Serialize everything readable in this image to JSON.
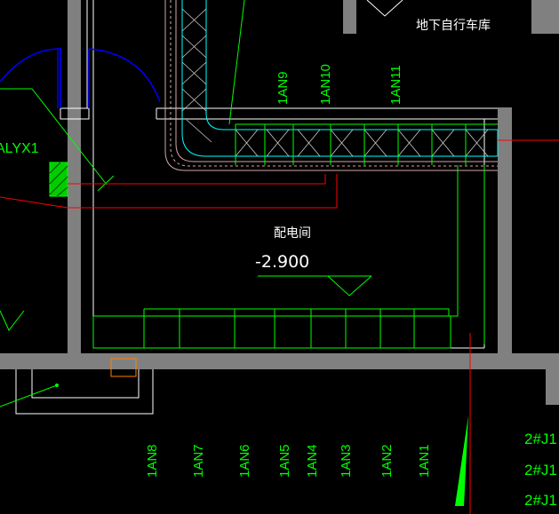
{
  "drawing": {
    "room_label": "地下自行车库",
    "electrical_room_label": "配电间",
    "elevation": "-2.900",
    "panel_label": "ALYX1",
    "top_circuits": [
      "1AN9",
      "1AN10",
      "1AN11"
    ],
    "bottom_circuits": [
      "1AN8",
      "1AN7",
      "1AN6",
      "1AN5",
      "1AN4",
      "1AN3",
      "1AN2",
      "1AN1"
    ],
    "right_tags": [
      "2#J1",
      "2#J1",
      "2#J1"
    ]
  },
  "colors": {
    "background": "#000000",
    "wall": "#808080",
    "outline": "#ffffff",
    "cable_tray": "#00ff00",
    "red_line": "#ff0000",
    "cyan": "#00ffff",
    "blue": "#0000ff",
    "hatch": "#d9a6a6",
    "orange": "#ff8000"
  }
}
